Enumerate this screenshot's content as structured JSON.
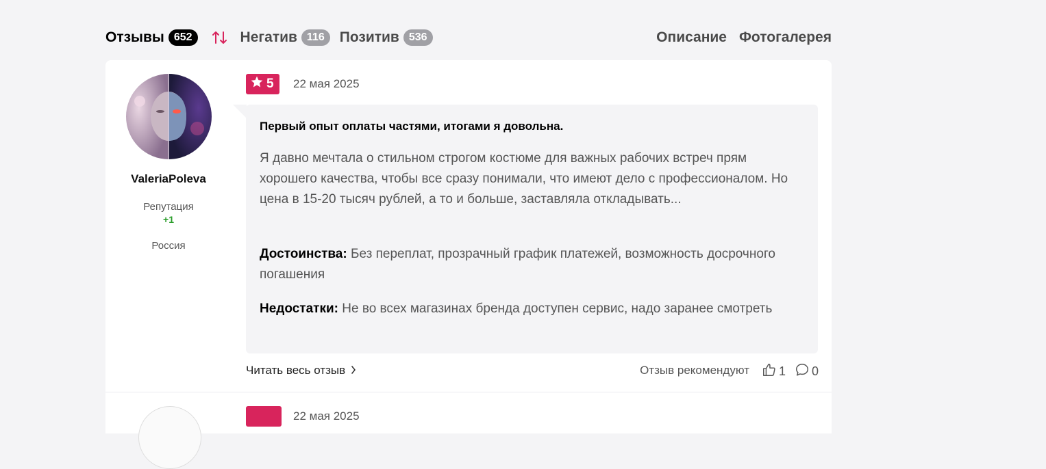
{
  "tabs": {
    "reviews_label": "Отзывы",
    "reviews_count": "652",
    "negative_label": "Негатив",
    "negative_count": "116",
    "positive_label": "Позитив",
    "positive_count": "536",
    "description_label": "Описание",
    "gallery_label": "Фотогалерея"
  },
  "colors": {
    "accent": "#d8245c",
    "positive_rep": "#2a9d2a"
  },
  "review": {
    "username": "ValeriaPoleva",
    "reputation_label": "Репутация",
    "reputation_value": "+1",
    "country": "Россия",
    "rating": "5",
    "date": "22 мая 2025",
    "title": "Первый опыт оплаты частями, итогами я довольна.",
    "text": "Я давно мечтала о стильном строгом костюме для важных рабочих встреч прям хорошего качества, чтобы все сразу понимали, что имеют дело с профессионалом. Но цена в 15-20 тысяч рублей, а то и больше, заставляла откладывать...",
    "pros_label": "Достоинства:",
    "pros_text": "Без переплат, прозрачный график платежей, возможность досрочного погашения",
    "cons_label": "Недостатки:",
    "cons_text": "Не во всех магазинах бренда доступен сервис, надо заранее смотреть",
    "read_more": "Читать весь отзыв",
    "recommend_label": "Отзыв рекомендуют",
    "likes": "1",
    "comments": "0"
  },
  "review2": {
    "date": "22 мая 2025"
  }
}
